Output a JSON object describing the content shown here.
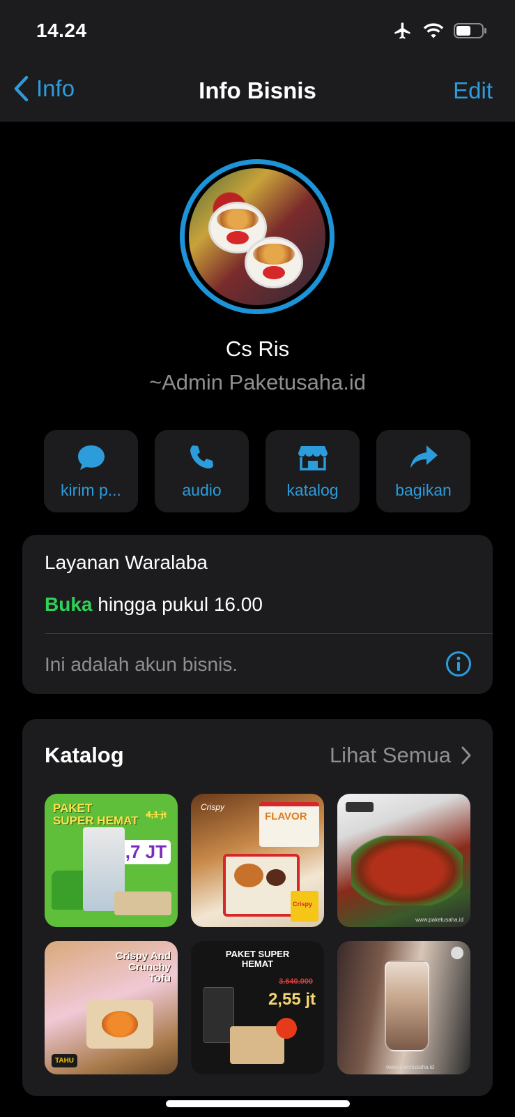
{
  "status_bar": {
    "time": "14.24"
  },
  "nav": {
    "back_label": "Info",
    "title": "Info Bisnis",
    "edit_label": "Edit"
  },
  "profile": {
    "name": "Cs Ris",
    "subtitle": "~Admin Paketusaha.id"
  },
  "actions": [
    {
      "label": "kirim p...",
      "icon": "message-icon"
    },
    {
      "label": "audio",
      "icon": "phone-icon"
    },
    {
      "label": "katalog",
      "icon": "storefront-icon"
    },
    {
      "label": "bagikan",
      "icon": "share-icon"
    }
  ],
  "business_info": {
    "category": "Layanan Waralaba",
    "open_status": "Buka",
    "hours": " hingga pukul 16.00",
    "account_note": "Ini adalah akun bisnis."
  },
  "catalog": {
    "title": "Katalog",
    "see_all": "Lihat Semua",
    "items": [
      {
        "line1": "PAKET",
        "line2": "SUPER HEMAT",
        "old_price": "4,1 jt",
        "price": "2,7 JT"
      },
      {
        "brand": "Crispy",
        "line1": "FLAVOR",
        "line2": "Crispy"
      },
      {
        "note": "www.paketusaha.id"
      },
      {
        "line1": "Crispy And",
        "line2": "Crunchy",
        "line3": "Tofu",
        "brand": "TAHU"
      },
      {
        "line1": "PAKET SUPER",
        "line2": "HEMAT",
        "old_price": "3.640.000",
        "price": "2,55 jt"
      },
      {
        "note": "www.paketusaha.id"
      }
    ]
  },
  "colors": {
    "accent": "#2d9cdb",
    "open": "#30d158",
    "background": "#000000",
    "card": "#1c1c1e"
  }
}
